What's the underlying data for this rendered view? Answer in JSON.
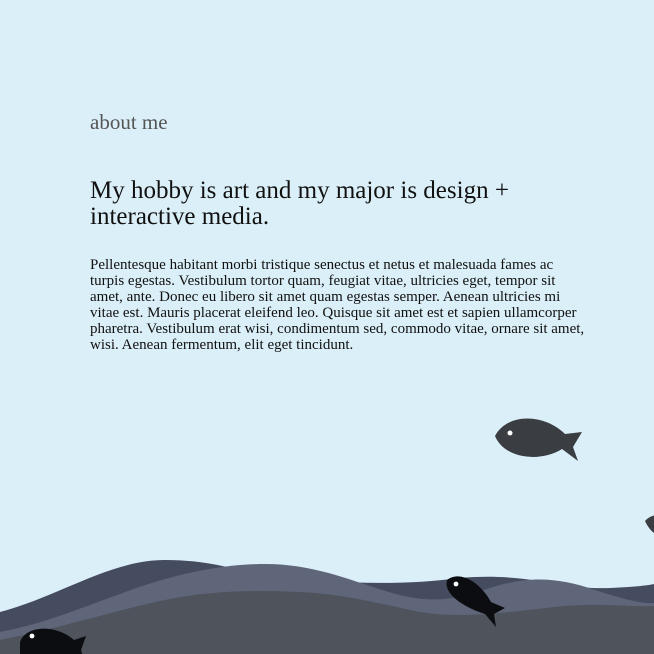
{
  "about": {
    "section_title": "about me",
    "headline": "My hobby is art and my major is design + interactive media.",
    "paragraph": "Pellentesque habitant morbi tristique senectus et netus et malesuada fames ac turpis egestas. Vestibulum tortor quam, feugiat vitae, ultricies eget, tempor sit amet, ante. Donec eu libero sit amet quam egestas semper. Aenean ultricies mi vitae est. Mauris placerat eleifend leo. Quisque sit amet est et sapien ullamcorper pharetra. Vestibulum erat wisi, condimentum sed, commodo vitae, ornare sit amet, wisi. Aenean fermentum, elit eget tincidunt."
  },
  "colors": {
    "background": "#dbeff8",
    "title_text": "#555555",
    "body_text": "#111111",
    "wave_back": "#454c60",
    "wave_mid": "#5f6679",
    "wave_front": "#4e535c",
    "fish": "#3a3d42",
    "fish_dark": "#0c0d10"
  },
  "decor": {
    "fish_icons": [
      "fish-icon",
      "fish-icon",
      "fish-icon",
      "fish-icon"
    ],
    "waves": "ocean-waves"
  }
}
